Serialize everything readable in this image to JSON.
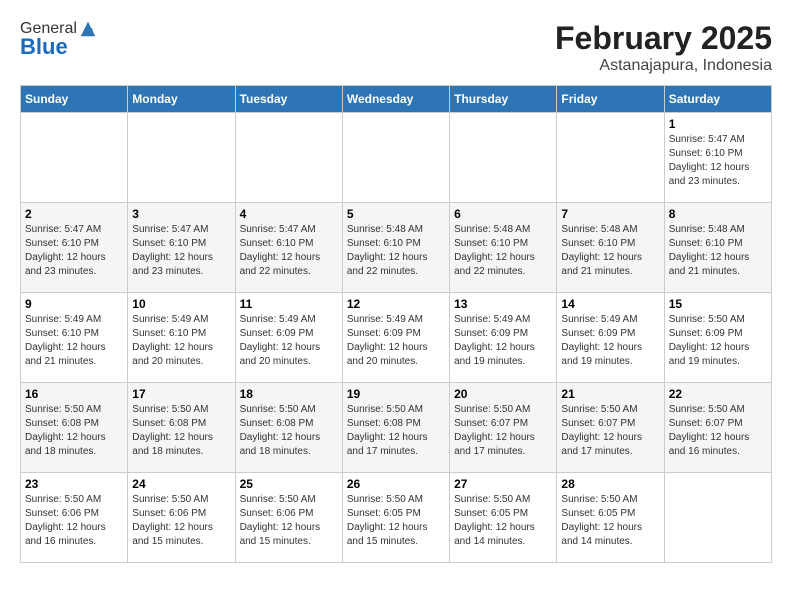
{
  "header": {
    "logo_general": "General",
    "logo_blue": "Blue",
    "title": "February 2025",
    "subtitle": "Astanajapura, Indonesia"
  },
  "weekdays": [
    "Sunday",
    "Monday",
    "Tuesday",
    "Wednesday",
    "Thursday",
    "Friday",
    "Saturday"
  ],
  "weeks": [
    [
      {
        "day": "",
        "info": ""
      },
      {
        "day": "",
        "info": ""
      },
      {
        "day": "",
        "info": ""
      },
      {
        "day": "",
        "info": ""
      },
      {
        "day": "",
        "info": ""
      },
      {
        "day": "",
        "info": ""
      },
      {
        "day": "1",
        "info": "Sunrise: 5:47 AM\nSunset: 6:10 PM\nDaylight: 12 hours and 23 minutes."
      }
    ],
    [
      {
        "day": "2",
        "info": "Sunrise: 5:47 AM\nSunset: 6:10 PM\nDaylight: 12 hours and 23 minutes."
      },
      {
        "day": "3",
        "info": "Sunrise: 5:47 AM\nSunset: 6:10 PM\nDaylight: 12 hours and 23 minutes."
      },
      {
        "day": "4",
        "info": "Sunrise: 5:47 AM\nSunset: 6:10 PM\nDaylight: 12 hours and 22 minutes."
      },
      {
        "day": "5",
        "info": "Sunrise: 5:48 AM\nSunset: 6:10 PM\nDaylight: 12 hours and 22 minutes."
      },
      {
        "day": "6",
        "info": "Sunrise: 5:48 AM\nSunset: 6:10 PM\nDaylight: 12 hours and 22 minutes."
      },
      {
        "day": "7",
        "info": "Sunrise: 5:48 AM\nSunset: 6:10 PM\nDaylight: 12 hours and 21 minutes."
      },
      {
        "day": "8",
        "info": "Sunrise: 5:48 AM\nSunset: 6:10 PM\nDaylight: 12 hours and 21 minutes."
      }
    ],
    [
      {
        "day": "9",
        "info": "Sunrise: 5:49 AM\nSunset: 6:10 PM\nDaylight: 12 hours and 21 minutes."
      },
      {
        "day": "10",
        "info": "Sunrise: 5:49 AM\nSunset: 6:10 PM\nDaylight: 12 hours and 20 minutes."
      },
      {
        "day": "11",
        "info": "Sunrise: 5:49 AM\nSunset: 6:09 PM\nDaylight: 12 hours and 20 minutes."
      },
      {
        "day": "12",
        "info": "Sunrise: 5:49 AM\nSunset: 6:09 PM\nDaylight: 12 hours and 20 minutes."
      },
      {
        "day": "13",
        "info": "Sunrise: 5:49 AM\nSunset: 6:09 PM\nDaylight: 12 hours and 19 minutes."
      },
      {
        "day": "14",
        "info": "Sunrise: 5:49 AM\nSunset: 6:09 PM\nDaylight: 12 hours and 19 minutes."
      },
      {
        "day": "15",
        "info": "Sunrise: 5:50 AM\nSunset: 6:09 PM\nDaylight: 12 hours and 19 minutes."
      }
    ],
    [
      {
        "day": "16",
        "info": "Sunrise: 5:50 AM\nSunset: 6:08 PM\nDaylight: 12 hours and 18 minutes."
      },
      {
        "day": "17",
        "info": "Sunrise: 5:50 AM\nSunset: 6:08 PM\nDaylight: 12 hours and 18 minutes."
      },
      {
        "day": "18",
        "info": "Sunrise: 5:50 AM\nSunset: 6:08 PM\nDaylight: 12 hours and 18 minutes."
      },
      {
        "day": "19",
        "info": "Sunrise: 5:50 AM\nSunset: 6:08 PM\nDaylight: 12 hours and 17 minutes."
      },
      {
        "day": "20",
        "info": "Sunrise: 5:50 AM\nSunset: 6:07 PM\nDaylight: 12 hours and 17 minutes."
      },
      {
        "day": "21",
        "info": "Sunrise: 5:50 AM\nSunset: 6:07 PM\nDaylight: 12 hours and 17 minutes."
      },
      {
        "day": "22",
        "info": "Sunrise: 5:50 AM\nSunset: 6:07 PM\nDaylight: 12 hours and 16 minutes."
      }
    ],
    [
      {
        "day": "23",
        "info": "Sunrise: 5:50 AM\nSunset: 6:06 PM\nDaylight: 12 hours and 16 minutes."
      },
      {
        "day": "24",
        "info": "Sunrise: 5:50 AM\nSunset: 6:06 PM\nDaylight: 12 hours and 15 minutes."
      },
      {
        "day": "25",
        "info": "Sunrise: 5:50 AM\nSunset: 6:06 PM\nDaylight: 12 hours and 15 minutes."
      },
      {
        "day": "26",
        "info": "Sunrise: 5:50 AM\nSunset: 6:05 PM\nDaylight: 12 hours and 15 minutes."
      },
      {
        "day": "27",
        "info": "Sunrise: 5:50 AM\nSunset: 6:05 PM\nDaylight: 12 hours and 14 minutes."
      },
      {
        "day": "28",
        "info": "Sunrise: 5:50 AM\nSunset: 6:05 PM\nDaylight: 12 hours and 14 minutes."
      },
      {
        "day": "",
        "info": ""
      }
    ]
  ]
}
